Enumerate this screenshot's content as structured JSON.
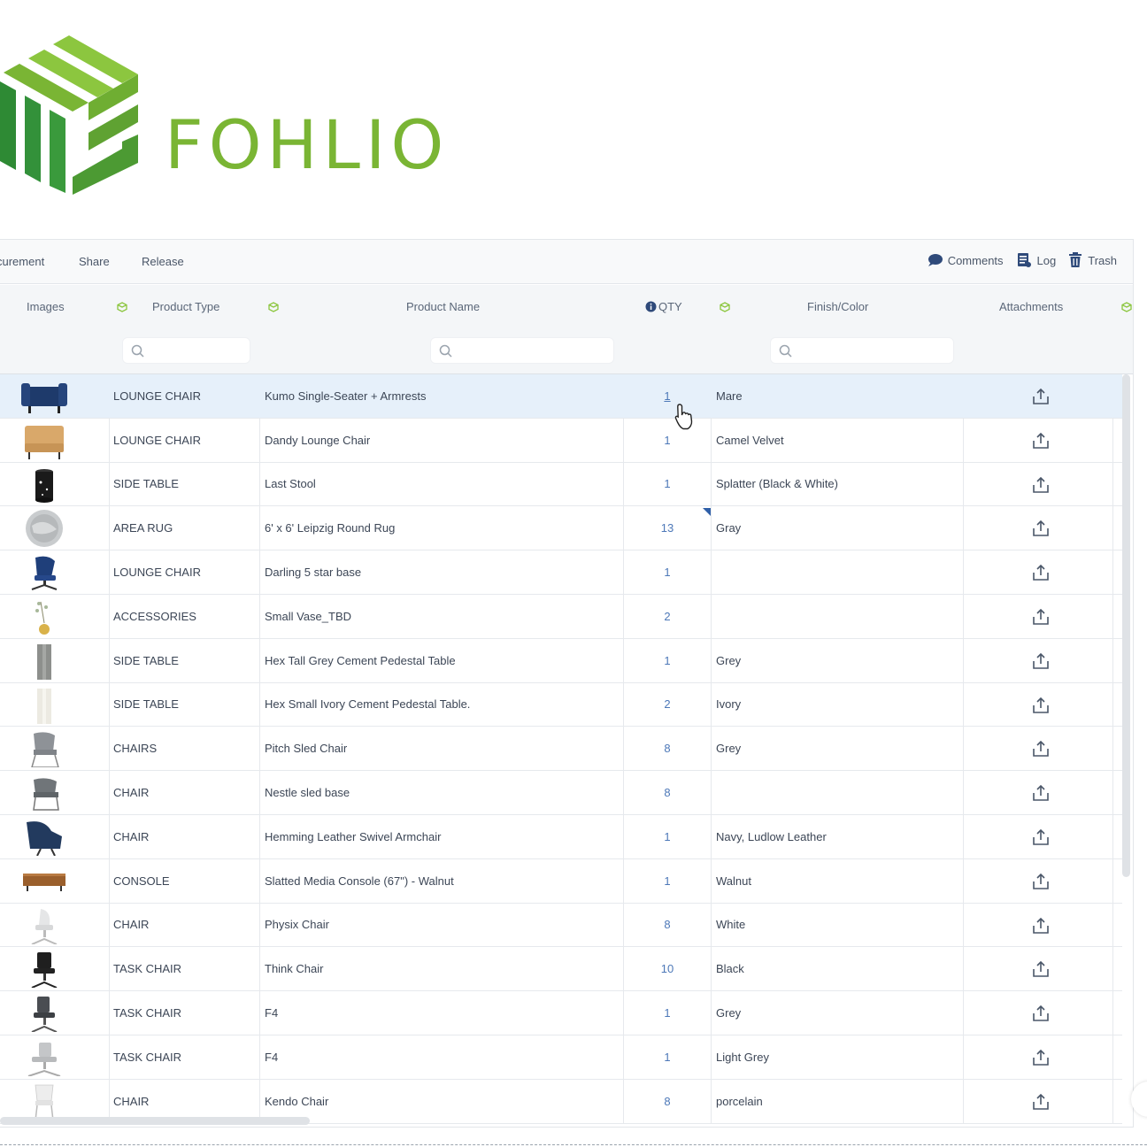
{
  "brand": {
    "name": "FOHLIO",
    "color": "#7ab534",
    "dark_color": "#2e8a34"
  },
  "toolbar": {
    "left_items": [
      "curement",
      "Share",
      "Release"
    ],
    "comments_label": "Comments",
    "log_label": "Log",
    "trash_label": "Trash"
  },
  "columns": {
    "images": "Images",
    "product_type": "Product Type",
    "product_name": "Product Name",
    "qty": "QTY",
    "finish_color": "Finish/Color",
    "attachments": "Attachments"
  },
  "search": {
    "placeholder": ""
  },
  "rows": [
    {
      "image": "navy-lounge-chair-thumb",
      "type": "LOUNGE CHAIR",
      "name": "Kumo Single-Seater + Armrests",
      "qty": "1",
      "finish": "Mare",
      "selected": true
    },
    {
      "image": "camel-lounge-chair-thumb",
      "type": "LOUNGE CHAIR",
      "name": "Dandy Lounge Chair",
      "qty": "1",
      "finish": "Camel Velvet"
    },
    {
      "image": "black-stool-thumb",
      "type": "SIDE TABLE",
      "name": "Last Stool",
      "qty": "1",
      "finish": "Splatter (Black & White)"
    },
    {
      "image": "round-rug-thumb",
      "type": "AREA RUG",
      "name": "6' x 6' Leipzig Round Rug",
      "qty": "13",
      "finish": "Gray"
    },
    {
      "image": "blue-swivel-chair-thumb",
      "type": "LOUNGE CHAIR",
      "name": "Darling 5 star base",
      "qty": "1",
      "finish": ""
    },
    {
      "image": "vase-thumb",
      "type": "ACCESSORIES",
      "name": "Small Vase_TBD",
      "qty": "2",
      "finish": ""
    },
    {
      "image": "grey-pedestal-thumb",
      "type": "SIDE TABLE",
      "name": "Hex Tall Grey Cement Pedestal Table",
      "qty": "1",
      "finish": "Grey"
    },
    {
      "image": "ivory-pedestal-thumb",
      "type": "SIDE TABLE",
      "name": "Hex Small Ivory Cement Pedestal Table.",
      "qty": "2",
      "finish": "Ivory"
    },
    {
      "image": "grey-sled-chair-thumb",
      "type": "CHAIRS",
      "name": "Pitch Sled Chair",
      "qty": "8",
      "finish": "Grey"
    },
    {
      "image": "sled-base-chair-thumb",
      "type": "CHAIR",
      "name": "Nestle sled base",
      "qty": "8",
      "finish": ""
    },
    {
      "image": "navy-armchair-thumb",
      "type": "CHAIR",
      "name": "Hemming Leather Swivel Armchair",
      "qty": "1",
      "finish": "Navy, Ludlow Leather"
    },
    {
      "image": "walnut-console-thumb",
      "type": "CONSOLE",
      "name": "Slatted Media Console (67\") - Walnut",
      "qty": "1",
      "finish": "Walnut"
    },
    {
      "image": "white-task-chair-thumb",
      "type": "CHAIR",
      "name": "Physix Chair",
      "qty": "8",
      "finish": "White"
    },
    {
      "image": "black-task-chair-thumb",
      "type": "TASK CHAIR",
      "name": "Think Chair",
      "qty": "10",
      "finish": "Black"
    },
    {
      "image": "grey-task-chair-thumb",
      "type": "TASK CHAIR",
      "name": "F4",
      "qty": "1",
      "finish": "Grey"
    },
    {
      "image": "light-grey-task-chair-thumb",
      "type": "TASK CHAIR",
      "name": "F4",
      "qty": "1",
      "finish": "Light Grey"
    },
    {
      "image": "white-chair-thumb",
      "type": "CHAIR",
      "name": "Kendo Chair",
      "qty": "8",
      "finish": "porcelain"
    }
  ]
}
